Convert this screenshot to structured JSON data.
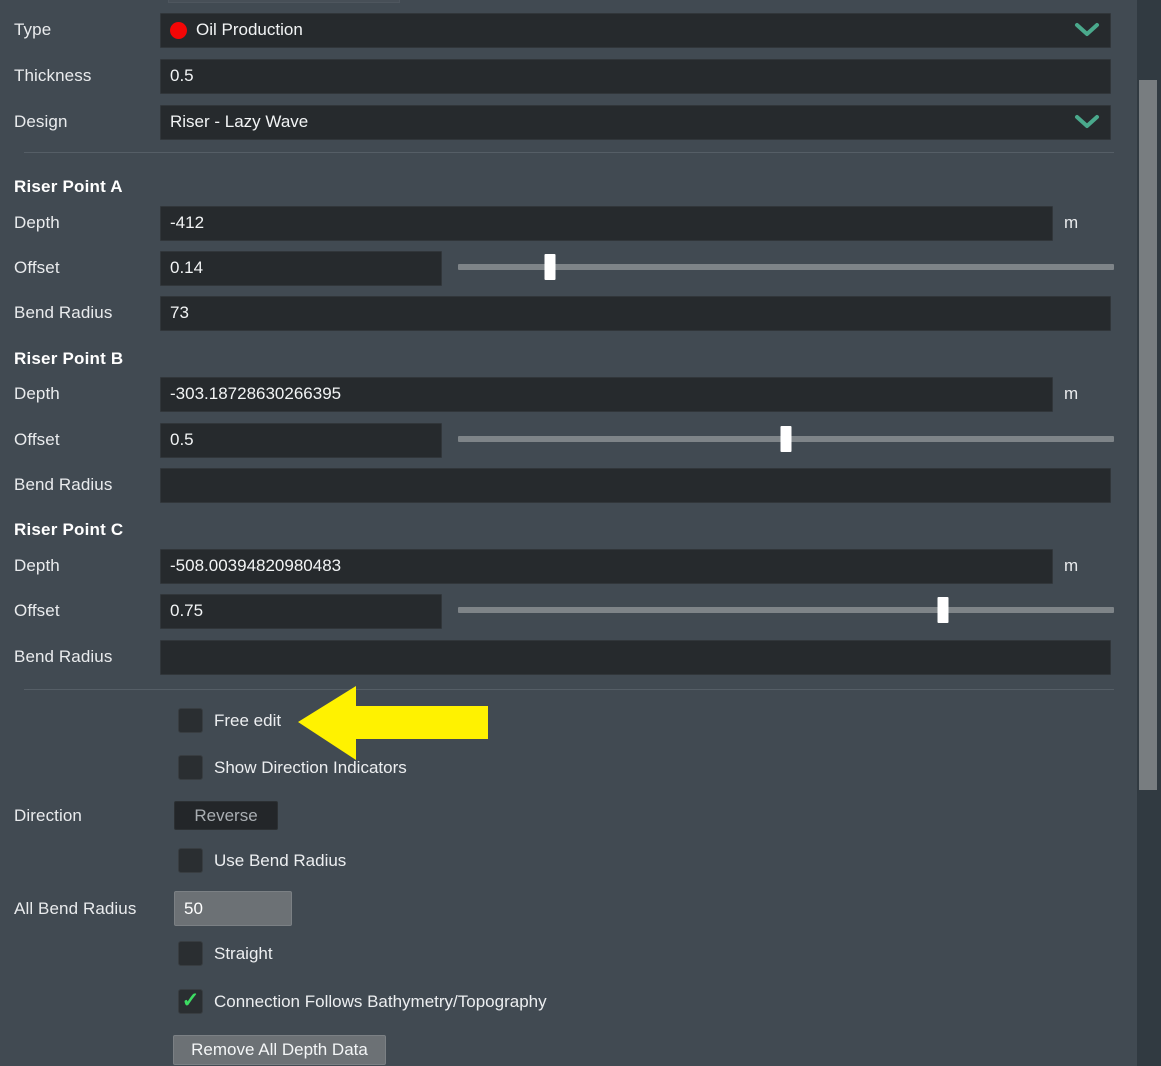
{
  "fields": {
    "type": {
      "label": "Type",
      "value": "Oil Production",
      "dot_color": "#f40606"
    },
    "thickness": {
      "label": "Thickness",
      "value": "0.5"
    },
    "design": {
      "label": "Design",
      "value": "Riser - Lazy Wave"
    }
  },
  "sections": [
    {
      "heading": "Riser Point A",
      "depth": {
        "label": "Depth",
        "value": "-412",
        "unit": "m"
      },
      "offset": {
        "label": "Offset",
        "value": "0.14",
        "slider_pct": 14
      },
      "bend_radius": {
        "label": "Bend Radius",
        "value": "73"
      }
    },
    {
      "heading": "Riser Point B",
      "depth": {
        "label": "Depth",
        "value": "-303.18728630266395",
        "unit": "m"
      },
      "offset": {
        "label": "Offset",
        "value": "0.5",
        "slider_pct": 50
      },
      "bend_radius": {
        "label": "Bend Radius",
        "value": ""
      }
    },
    {
      "heading": "Riser Point C",
      "depth": {
        "label": "Depth",
        "value": "-508.00394820980483",
        "unit": "m"
      },
      "offset": {
        "label": "Offset",
        "value": "0.75",
        "slider_pct": 74
      },
      "bend_radius": {
        "label": "Bend Radius",
        "value": ""
      }
    }
  ],
  "options": {
    "free_edit": {
      "label": "Free edit",
      "checked": false
    },
    "show_direction_indicators": {
      "label": "Show Direction Indicators",
      "checked": false
    },
    "direction": {
      "label": "Direction",
      "button_label": "Reverse"
    },
    "use_bend_radius": {
      "label": "Use Bend Radius",
      "checked": false
    },
    "all_bend_radius": {
      "label": "All Bend Radius",
      "value": "50"
    },
    "straight": {
      "label": "Straight",
      "checked": false
    },
    "connection_follows": {
      "label": "Connection Follows Bathymetry/Topography",
      "checked": true,
      "tick": "✓"
    },
    "remove_all_depth_data": {
      "label": "Remove All Depth Data"
    }
  },
  "colors": {
    "panel_bg": "#414a52",
    "field_bg": "#262a2d",
    "chevron": "#4aa98c",
    "check_green": "#3ddc63",
    "annotation_arrow": "#fff200",
    "slider_track": "#7e8488",
    "slider_thumb": "#ffffff"
  }
}
